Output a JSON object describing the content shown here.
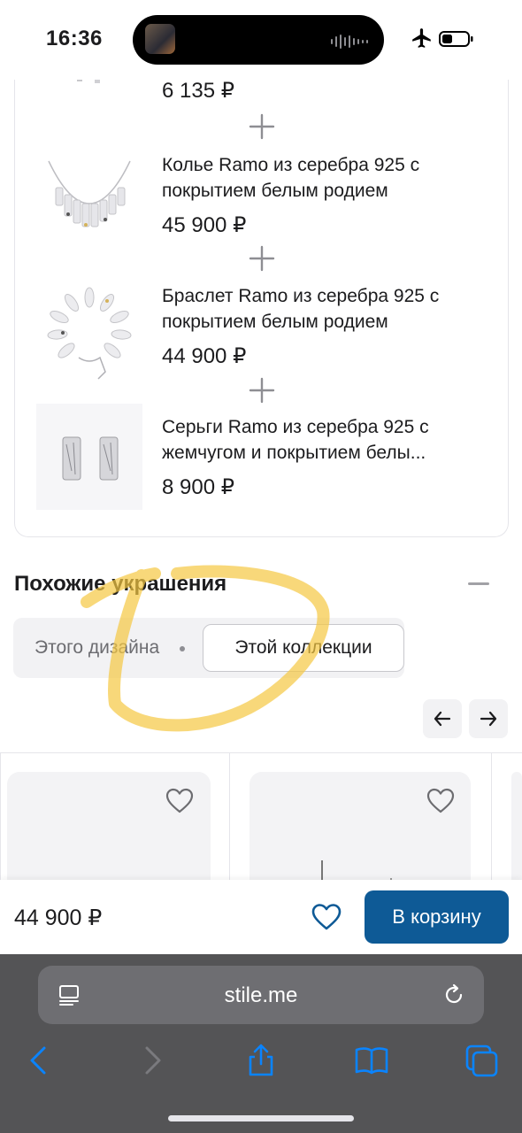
{
  "status_bar": {
    "time": "16:36",
    "icons": [
      "airplane-icon",
      "battery-icon"
    ]
  },
  "bundle": {
    "items": [
      {
        "title_line1": "",
        "title_line2": "",
        "price": "6 135 ₽",
        "image": "earring-fragment"
      },
      {
        "title_line1": "Колье Ramo из серебра 925 с",
        "title_line2": "покрытием белым родием",
        "price": "45 900 ₽",
        "image": "necklace"
      },
      {
        "title_line1": "Браслет Ramo из серебра 925 с",
        "title_line2": "покрытием белым родием",
        "price": "44 900 ₽",
        "image": "bracelet"
      },
      {
        "title_line1": "Серьги Ramo из серебра 925 с",
        "title_line2": "жемчугом и покрытием белы...",
        "price": "8 900 ₽",
        "image": "earrings"
      }
    ]
  },
  "similar": {
    "title": "Похожие украшения",
    "tab_design": "Этого дизайна",
    "tab_collection": "Этой коллекции",
    "active_tab": "Этой коллекции"
  },
  "buy_bar": {
    "price": "44 900 ₽",
    "cart_label": "В корзину"
  },
  "browser": {
    "url": "stile.me"
  },
  "colors": {
    "accent": "#0e5a96",
    "highlight": "#f5c842",
    "safari_bg": "#545456"
  }
}
